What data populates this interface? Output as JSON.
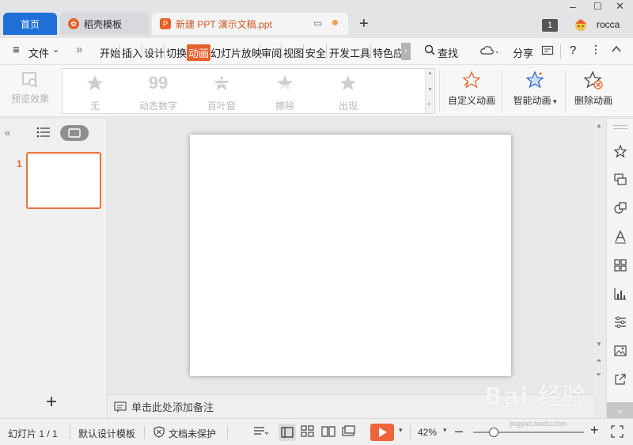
{
  "titlebar": {
    "home_tab": "首页",
    "docer_tab": "稻壳模板",
    "doc_tab": "新建 PPT 演示文稿.ppt",
    "badge": "1",
    "user": "rocca"
  },
  "menu": {
    "file": "文件",
    "items": [
      "开始",
      "插入",
      "设计",
      "切换",
      "动画",
      "幻灯片放映",
      "审阅",
      "视图",
      "安全",
      "开发工具",
      "特色应"
    ],
    "search": "查找",
    "share": "分享",
    "help": "?"
  },
  "ribbon": {
    "preview": "预览效果",
    "gallery": [
      "无",
      "动态数字",
      "百叶窗",
      "擦除",
      "出现"
    ],
    "custom_anim": "自定义动画",
    "smart_anim": "智能动画",
    "delete_anim": "删除动画"
  },
  "slides": {
    "number": "1"
  },
  "notes": {
    "placeholder": "单击此处添加备注"
  },
  "status": {
    "slide_count": "幻灯片 1 / 1",
    "template": "默认设计模板",
    "protect": "文档未保护",
    "zoom": "42%"
  },
  "watermark": {
    "brand": "Bai 经验",
    "url": "jingyan.baidu.com"
  },
  "colors": {
    "accent": "#e8612c",
    "home_tab": "#1f6fd6",
    "play": "#f0643c"
  }
}
